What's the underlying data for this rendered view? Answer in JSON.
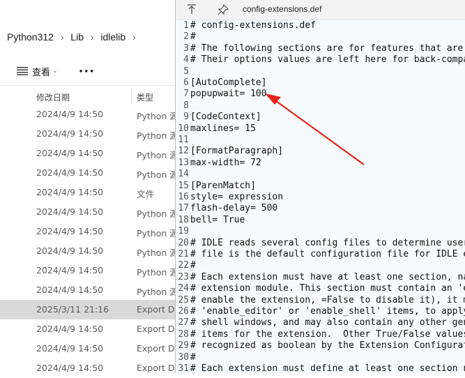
{
  "explorer": {
    "breadcrumb": [
      "Python312",
      "Lib",
      "idlelib"
    ],
    "view_label": "查看",
    "more_label": "···",
    "columns": {
      "date": "修改日期",
      "type": "类型"
    },
    "rows": [
      {
        "date": "2024/4/9 14:50",
        "type": "Python 源"
      },
      {
        "date": "2024/4/9 14:50",
        "type": "Python 源"
      },
      {
        "date": "2024/4/9 14:50",
        "type": "Python 源"
      },
      {
        "date": "2024/4/9 14:50",
        "type": "Python 源"
      },
      {
        "date": "2024/4/9 14:50",
        "type": "文件"
      },
      {
        "date": "2024/4/9 14:50",
        "type": "Python 源"
      },
      {
        "date": "2024/4/9 14:50",
        "type": "Python 源"
      },
      {
        "date": "2024/4/9 14:50",
        "type": "Python 源"
      },
      {
        "date": "2024/4/9 14:50",
        "type": "Python 源"
      },
      {
        "date": "2024/4/9 14:50",
        "type": "Python 源"
      },
      {
        "date": "2025/3/11 21:16",
        "type": "Export De",
        "selected": true
      },
      {
        "date": "2024/4/9 14:50",
        "type": "Export De"
      },
      {
        "date": "2024/4/9 14:50",
        "type": "Export De"
      },
      {
        "date": "2024/4/9 14:50",
        "type": "Export De"
      }
    ]
  },
  "notepad": {
    "title": "config-extensions.def",
    "lines": [
      {
        "n": "1",
        "text": "# config-extensions.def"
      },
      {
        "n": "2",
        "text": "#"
      },
      {
        "n": "3",
        "text": "# The following sections are for features that are no"
      },
      {
        "n": "4",
        "text": "# Their options values are left here for back-compat"
      },
      {
        "n": "5",
        "text": ""
      },
      {
        "n": "6",
        "text": "[AutoComplete]"
      },
      {
        "n": "7",
        "text": "popupwait= 100"
      },
      {
        "n": "8",
        "text": ""
      },
      {
        "n": "9",
        "text": "[CodeContext]"
      },
      {
        "n": "10",
        "text": "maxlines= 15"
      },
      {
        "n": "11",
        "text": ""
      },
      {
        "n": "12",
        "text": "[FormatParagraph]"
      },
      {
        "n": "13",
        "text": "max-width= 72"
      },
      {
        "n": "14",
        "text": ""
      },
      {
        "n": "15",
        "text": "[ParenMatch]"
      },
      {
        "n": "16",
        "text": "style= expression"
      },
      {
        "n": "17",
        "text": "flash-delay= 500"
      },
      {
        "n": "18",
        "text": "bell= True"
      },
      {
        "n": "19",
        "text": ""
      },
      {
        "n": "20",
        "text": "# IDLE reads several config files to determine user"
      },
      {
        "n": "21",
        "text": "# file is the default configuration file for IDLE ex"
      },
      {
        "n": "22",
        "text": "#"
      },
      {
        "n": "23",
        "text": "# Each extension must have at least one section, nam"
      },
      {
        "n": "24",
        "text": "# extension module. This section must contain an 'en"
      },
      {
        "n": "25",
        "text": "# enable the extension, =False to disable it), it ma"
      },
      {
        "n": "26",
        "text": "# 'enable_editor' or 'enable_shell' items, to apply"
      },
      {
        "n": "27",
        "text": "# shell windows, and may also contain any other gene"
      },
      {
        "n": "28",
        "text": "# items for the extension.  Other True/False values"
      },
      {
        "n": "29",
        "text": "# recognized as boolean by the Extension Configurati"
      },
      {
        "n": "30",
        "text": "#"
      },
      {
        "n": "31",
        "text": "# Each extension must define at least one section na"
      }
    ]
  },
  "annotation": {
    "color": "#e8231a"
  }
}
